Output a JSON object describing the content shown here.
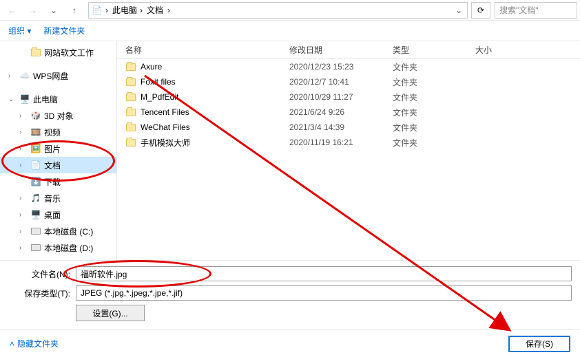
{
  "nav": {
    "breadcrumb": [
      "此电脑",
      "文档"
    ],
    "search_placeholder": "搜索\"文档\""
  },
  "toolbar": {
    "organize": "组织",
    "new_folder": "新建文件夹"
  },
  "sidebar": {
    "items": [
      {
        "label": "网站软文工作",
        "icon": "folder",
        "indent": 1,
        "expander": ""
      },
      {
        "label": "WPS网盘",
        "icon": "wps",
        "indent": 0,
        "expander": "›"
      },
      {
        "label": "此电脑",
        "icon": "pc",
        "indent": 0,
        "expander": "⌄"
      },
      {
        "label": "3D 对象",
        "icon": "3d",
        "indent": 1,
        "expander": "›"
      },
      {
        "label": "视频",
        "icon": "video",
        "indent": 1,
        "expander": "›"
      },
      {
        "label": "图片",
        "icon": "pic",
        "indent": 1,
        "expander": "›"
      },
      {
        "label": "文档",
        "icon": "doc",
        "indent": 1,
        "expander": "›",
        "selected": true
      },
      {
        "label": "下载",
        "icon": "dl",
        "indent": 1,
        "expander": ""
      },
      {
        "label": "音乐",
        "icon": "music",
        "indent": 1,
        "expander": "›"
      },
      {
        "label": "桌面",
        "icon": "desk",
        "indent": 1,
        "expander": "›"
      },
      {
        "label": "本地磁盘 (C:)",
        "icon": "disk",
        "indent": 1,
        "expander": "›"
      },
      {
        "label": "本地磁盘 (D:)",
        "icon": "disk",
        "indent": 1,
        "expander": "›"
      }
    ]
  },
  "columns": {
    "name": "名称",
    "date": "修改日期",
    "type": "类型",
    "size": "大小"
  },
  "files": [
    {
      "name": "Axure",
      "date": "2020/12/23 15:23",
      "type": "文件夹"
    },
    {
      "name": "Foxit files",
      "date": "2020/12/7 10:41",
      "type": "文件夹"
    },
    {
      "name": "M_PdfEdit",
      "date": "2020/10/29 11:27",
      "type": "文件夹"
    },
    {
      "name": "Tencent Files",
      "date": "2021/6/24 9:26",
      "type": "文件夹"
    },
    {
      "name": "WeChat Files",
      "date": "2021/3/4 14:39",
      "type": "文件夹"
    },
    {
      "name": "手机模拟大师",
      "date": "2020/11/19 16:21",
      "type": "文件夹"
    }
  ],
  "form": {
    "filename_label": "文件名(N):",
    "filename_value": "福昕软件.jpg",
    "filetype_label": "保存类型(T):",
    "filetype_value": "JPEG (*.jpg,*.jpeg,*.jpe,*.jif)",
    "settings_label": "设置(G)..."
  },
  "footer": {
    "hide_folders": "隐藏文件夹",
    "save": "保存(S)"
  }
}
